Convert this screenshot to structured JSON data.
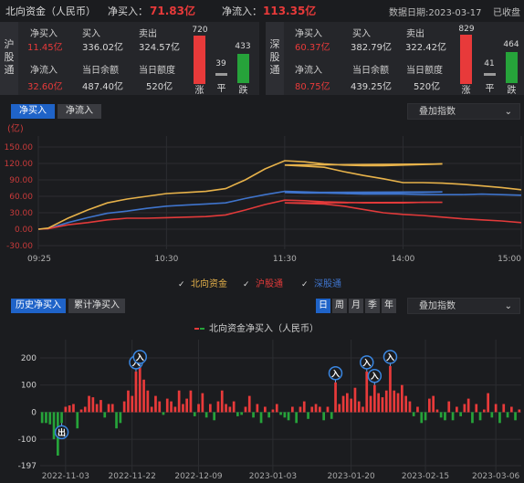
{
  "header": {
    "title": "北向资金（人民币）",
    "net_buy_label": "净买入：",
    "net_buy_value": "71.83亿",
    "net_inflow_label": "净流入：",
    "net_inflow_value": "113.35亿",
    "date_text": "数据日期:2023-03-17",
    "status": "已收盘"
  },
  "sh": {
    "tab_label": "沪股通",
    "net_buy_label": "净买入",
    "net_buy_value": "11.45亿",
    "buy_label": "买入",
    "buy_value": "336.02亿",
    "sell_label": "卖出",
    "sell_value": "324.57亿",
    "net_inflow_label": "净流入",
    "net_inflow_value": "32.60亿",
    "balance_label": "当日余额",
    "balance_value": "487.40亿",
    "quota_label": "当日额度",
    "quota_value": "520亿",
    "up_count": "720",
    "flat_count": "39",
    "down_count": "433",
    "up_label": "涨",
    "flat_label": "平",
    "down_label": "跌"
  },
  "sz": {
    "tab_label": "深股通",
    "net_buy_label": "净买入",
    "net_buy_value": "60.37亿",
    "buy_label": "买入",
    "buy_value": "382.79亿",
    "sell_label": "卖出",
    "sell_value": "322.42亿",
    "net_inflow_label": "净流入",
    "net_inflow_value": "80.75亿",
    "balance_label": "当日余额",
    "balance_value": "439.25亿",
    "quota_label": "当日额度",
    "quota_value": "520亿",
    "up_count": "829",
    "flat_count": "41",
    "down_count": "464",
    "up_label": "涨",
    "flat_label": "平",
    "down_label": "跌"
  },
  "intraday_controls": {
    "tab_net_buy": "净买入",
    "tab_net_inflow": "净流入",
    "overlay_label": "叠加指数"
  },
  "history_controls": {
    "tab_history": "历史净买入",
    "tab_cumulative": "累计净买入",
    "period_day": "日",
    "period_week": "周",
    "period_month": "月",
    "period_quarter": "季",
    "period_year": "年",
    "overlay_label": "叠加指数"
  },
  "colors": {
    "north": "#e7b24a",
    "sh": "#e23a3a",
    "sz": "#3f74cc",
    "up": "#e83a3a",
    "down": "#26a33a",
    "accent": "#1f63c8"
  },
  "chart_data": [
    {
      "type": "line",
      "unit_label": "(亿)",
      "x_ticks": [
        "09:25",
        "10:30",
        "11:30",
        "14:00",
        "15:00"
      ],
      "y_ticks": [
        150,
        120,
        90,
        60,
        30,
        0,
        -30
      ],
      "ylim": [
        -30,
        150
      ],
      "legend": [
        "北向资金",
        "沪股通",
        "深股通"
      ],
      "x_points": [
        "09:25",
        "09:30",
        "09:40",
        "09:50",
        "10:00",
        "10:10",
        "10:20",
        "10:30",
        "10:40",
        "10:50",
        "11:00",
        "11:10",
        "11:20",
        "11:30",
        "11:40",
        "11:50",
        "12:00",
        "12:10",
        "12:20",
        "12:30",
        "12:40",
        "12:50",
        "13:00",
        "13:10",
        "13:20",
        "13:30",
        "13:40",
        "13:50",
        "14:00",
        "14:10",
        "14:20",
        "14:30",
        "14:40",
        "14:50",
        "15:00"
      ],
      "series": [
        {
          "name": "北向资金",
          "values": [
            0,
            2,
            20,
            35,
            48,
            55,
            60,
            65,
            67,
            69,
            74,
            90,
            110,
            125,
            123,
            119,
            117,
            116,
            116,
            117,
            118,
            119,
            117,
            115,
            113,
            105,
            98,
            92,
            85,
            85,
            84,
            82,
            79,
            76,
            72
          ]
        },
        {
          "name": "沪股通",
          "values": [
            0,
            1,
            8,
            12,
            17,
            20,
            20,
            21,
            22,
            23,
            26,
            35,
            45,
            53,
            52,
            50,
            49,
            48,
            48,
            48,
            49,
            49,
            48,
            47,
            46,
            42,
            36,
            30,
            27,
            25,
            22,
            19,
            17,
            15,
            12
          ]
        },
        {
          "name": "深股通",
          "values": [
            0,
            1,
            12,
            21,
            29,
            33,
            38,
            42,
            44,
            46,
            48,
            56,
            63,
            69,
            68,
            67,
            66,
            66,
            66,
            67,
            67,
            68,
            67,
            66,
            66,
            65,
            64,
            64,
            64,
            63,
            63,
            63,
            64,
            63,
            62
          ]
        }
      ]
    },
    {
      "type": "bar",
      "title": "北向资金净买入（人民币）",
      "y_ticks": [
        200,
        100,
        0,
        -100,
        -197
      ],
      "ylim": [
        -197,
        200
      ],
      "x_ticks": [
        "2022-11-03",
        "2022-11-22",
        "2022-12-09",
        "2023-01-03",
        "2023-01-20",
        "2023-02-15",
        "2023-03-06"
      ],
      "annotations": [
        {
          "label": "出",
          "index": 5
        },
        {
          "label": "入",
          "index": 24
        },
        {
          "label": "入",
          "index": 25
        },
        {
          "label": "入",
          "index": 75
        },
        {
          "label": "入",
          "index": 83
        },
        {
          "label": "入",
          "index": 85
        },
        {
          "label": "入",
          "index": 89
        }
      ],
      "values": [
        -40,
        -40,
        -45,
        -100,
        -160,
        -40,
        20,
        25,
        30,
        -60,
        10,
        20,
        60,
        55,
        30,
        45,
        -20,
        30,
        30,
        -60,
        -40,
        40,
        80,
        60,
        150,
        170,
        120,
        80,
        20,
        60,
        40,
        -10,
        50,
        40,
        20,
        80,
        30,
        50,
        80,
        -15,
        30,
        70,
        -20,
        30,
        -30,
        40,
        80,
        30,
        20,
        40,
        -15,
        -10,
        20,
        60,
        -20,
        30,
        -40,
        20,
        -20,
        10,
        30,
        -10,
        -20,
        -30,
        20,
        -40,
        20,
        40,
        -25,
        20,
        30,
        20,
        -30,
        20,
        -25,
        110,
        30,
        60,
        70,
        50,
        90,
        40,
        20,
        150,
        60,
        100,
        70,
        55,
        80,
        170,
        80,
        70,
        100,
        60,
        40,
        -15,
        20,
        -40,
        -30,
        50,
        60,
        10,
        -20,
        -30,
        40,
        -30,
        20,
        -15,
        30,
        50,
        -40,
        30,
        -30,
        10,
        70,
        -20,
        30,
        -40,
        30,
        -20,
        20,
        -30,
        10
      ]
    }
  ]
}
